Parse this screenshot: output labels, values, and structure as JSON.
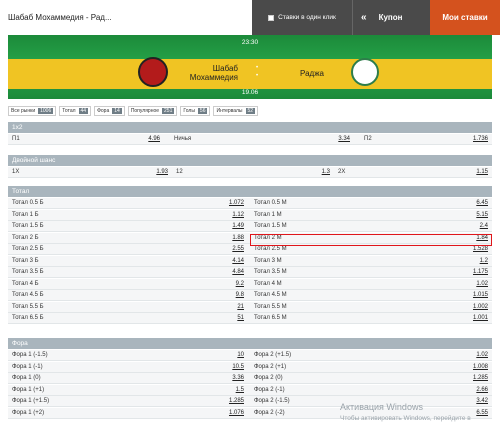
{
  "header": {
    "match_title": "Шабаб Мохаммедия - Рад...",
    "single_click_label": "Ставки в один клик",
    "coupon_label": "Купон",
    "my_bets_label": "Мои ставки"
  },
  "match": {
    "time": "23:30",
    "date": "19.06",
    "team1": "Шабаб Мохаммедия",
    "team2": "Раджа"
  },
  "filters": [
    {
      "label": "Все рынки",
      "count": "1006"
    },
    {
      "label": "Тотал",
      "count": "44"
    },
    {
      "label": "Фора",
      "count": "14"
    },
    {
      "label": "Популярное",
      "count": "251"
    },
    {
      "label": "Голы",
      "count": "56"
    },
    {
      "label": "Интервалы",
      "count": "52"
    }
  ],
  "markets": {
    "m1x2": {
      "title": "1x2",
      "cells": [
        {
          "label": "П1",
          "odds": "4.96"
        },
        {
          "label": "Ничья",
          "odds": "3.34"
        },
        {
          "label": "П2",
          "odds": "1.736"
        }
      ]
    },
    "dc": {
      "title": "Двойной шанс",
      "cells": [
        {
          "label": "1X",
          "odds": "1.93"
        },
        {
          "label": "12",
          "odds": "1.3"
        },
        {
          "label": "2X",
          "odds": "1.15"
        }
      ]
    },
    "total": {
      "title": "Тотал",
      "rows": [
        {
          "l": "Тотал 0.5 Б",
          "lo": "1.072",
          "r": "Тотал 0.5 М",
          "ro": "6.45"
        },
        {
          "l": "Тотал 1 Б",
          "lo": "1.12",
          "r": "Тотал 1 М",
          "ro": "5.15"
        },
        {
          "l": "Тотал 1.5 Б",
          "lo": "1.49",
          "r": "Тотал 1.5 М",
          "ro": "2.4"
        },
        {
          "l": "Тотал 2 Б",
          "lo": "1.88",
          "r": "Тотал 2 М",
          "ro": "1.84"
        },
        {
          "l": "Тотал 2.5 Б",
          "lo": "2.55",
          "r": "Тотал 2.5 М",
          "ro": "1.528"
        },
        {
          "l": "Тотал 3 Б",
          "lo": "4.14",
          "r": "Тотал 3 М",
          "ro": "1.2"
        },
        {
          "l": "Тотал 3.5 Б",
          "lo": "4.84",
          "r": "Тотал 3.5 М",
          "ro": "1.175"
        },
        {
          "l": "Тотал 4 Б",
          "lo": "9.2",
          "r": "Тотал 4 М",
          "ro": "1.02"
        },
        {
          "l": "Тотал 4.5 Б",
          "lo": "9.8",
          "r": "Тотал 4.5 М",
          "ro": "1.015"
        },
        {
          "l": "Тотал 5.5 Б",
          "lo": "21",
          "r": "Тотал 5.5 М",
          "ro": "1.002"
        },
        {
          "l": "Тотал 6.5 Б",
          "lo": "51",
          "r": "Тотал 6.5 М",
          "ro": "1.001"
        }
      ]
    },
    "fora": {
      "title": "Фора",
      "rows": [
        {
          "l": "Фора 1 (-1.5)",
          "lo": "10",
          "r": "Фора 2 (+1.5)",
          "ro": "1.02"
        },
        {
          "l": "Фора 1 (-1)",
          "lo": "10.5",
          "r": "Фора 2 (+1)",
          "ro": "1.008"
        },
        {
          "l": "Фора 1 (0)",
          "lo": "3.36",
          "r": "Фора 2 (0)",
          "ro": "1.285"
        },
        {
          "l": "Фора 1 (+1)",
          "lo": "1.5",
          "r": "Фора 2 (-1)",
          "ro": "2.66"
        },
        {
          "l": "Фора 1 (+1.5)",
          "lo": "1.285",
          "r": "Фора 2 (-1.5)",
          "ro": "3.42"
        },
        {
          "l": "Фора 1 (+2)",
          "lo": "1.076",
          "r": "Фора 2 (-2)",
          "ro": "6.55"
        }
      ]
    }
  },
  "watermark": {
    "line1": "Активация Windows",
    "line2": "Чтобы активировать Windows, перейдите в"
  },
  "colors": {
    "accent": "#d4521e",
    "banner_green": "#26a64a",
    "banner_yellow": "#f0c423",
    "highlight": "#e0161b"
  }
}
